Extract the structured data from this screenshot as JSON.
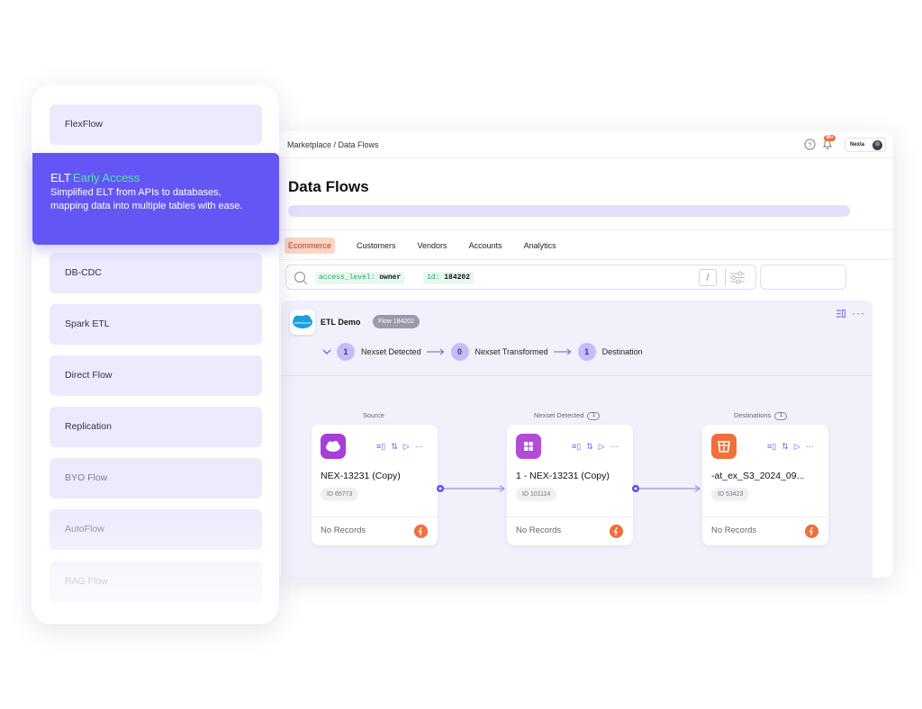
{
  "app": {
    "breadcrumb": "Marketplace / Data Flows",
    "notification_badge": "99+",
    "user_name": "Nexla",
    "page_title": "Data Flows",
    "tabs": [
      {
        "label": "Ecommerce",
        "active": true
      },
      {
        "label": "Customers",
        "active": false
      },
      {
        "label": "Vendors",
        "active": false
      },
      {
        "label": "Accounts",
        "active": false
      },
      {
        "label": "Analytics",
        "active": false
      }
    ],
    "search": {
      "filters": [
        {
          "key": "access_level:",
          "value": "owner"
        },
        {
          "key": "id:",
          "value": "184202"
        }
      ],
      "shortcut": "/"
    }
  },
  "flow": {
    "logo_text": "salesforce",
    "name": "ETL Demo",
    "flow_pill": "Flow 184202",
    "menu_icon": "list-icon",
    "more": "···",
    "pipeline": [
      {
        "count": "1",
        "label": "Nexset Detected"
      },
      {
        "count": "0",
        "label": "Nexset Transformed"
      },
      {
        "count": "1",
        "label": "Destination"
      }
    ],
    "columns": [
      {
        "heading": "Source",
        "badge": ""
      },
      {
        "heading": "Nexset Detected",
        "badge": "1"
      },
      {
        "heading": "Destinations",
        "badge": "1"
      }
    ],
    "cards": [
      {
        "name": "NEX-13231 (Copy)",
        "id": "ID 65773",
        "records": "No Records",
        "logo_color": "#a53fd8",
        "icon": "salesforce-cloud-icon"
      },
      {
        "name": "1 - NEX-13231 (Copy)",
        "id": "ID 101114",
        "records": "No Records",
        "logo_color": "#b24bd8",
        "icon": "nexset-grid-icon"
      },
      {
        "name": "-at_ex_S3_2024_09...",
        "id": "ID 53423",
        "records": "No Records",
        "logo_color": "#f06f3a",
        "icon": "s3-bucket-icon"
      }
    ]
  },
  "side": {
    "items": [
      {
        "label": "FlexFlow"
      },
      {
        "label": "DB-CDC"
      },
      {
        "label": "Spark ETL"
      },
      {
        "label": "Direct Flow"
      },
      {
        "label": "Replication"
      },
      {
        "label": "BYO Flow"
      },
      {
        "label": "AutoFlow"
      },
      {
        "label": "RAG Flow"
      }
    ],
    "featured": {
      "title": "ELT",
      "badge": "Early Access",
      "description": "Simplified ELT from APIs to databases, mapping data into multiple tables with ease."
    }
  },
  "colors": {
    "accent": "#6456f4",
    "early_access": "#4fe3b0",
    "active_tab_bg": "#fcd5c8",
    "panel_bg": "#f2f1fb",
    "record_status": "#f06f3a"
  }
}
